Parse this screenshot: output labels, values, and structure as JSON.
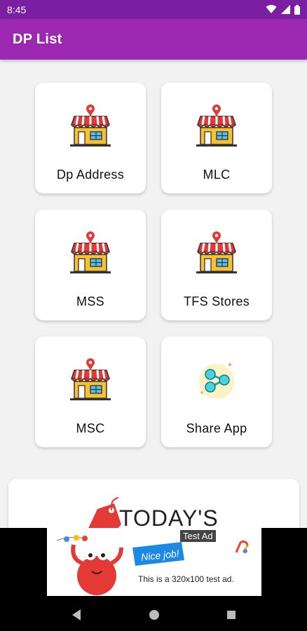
{
  "status_bar": {
    "time": "8:45",
    "icons": [
      "wifi-icon",
      "signal-icon",
      "battery-icon"
    ]
  },
  "app_bar": {
    "title": "DP List"
  },
  "grid": {
    "items": [
      {
        "label": "Dp Address",
        "icon": "store-icon"
      },
      {
        "label": "MLC",
        "icon": "store-icon"
      },
      {
        "label": "MSS",
        "icon": "store-icon"
      },
      {
        "label": "TFS Stores",
        "icon": "store-icon"
      },
      {
        "label": "MSC",
        "icon": "store-icon"
      },
      {
        "label": "Share App",
        "icon": "share-icon"
      }
    ]
  },
  "promo": {
    "text": "TODAY'S"
  },
  "ad": {
    "badge": "Test Ad",
    "flag_text": "Nice job!",
    "text": "This is a 320x100 test ad."
  },
  "nav": {
    "buttons": [
      "back",
      "home",
      "recents"
    ]
  },
  "colors": {
    "status_bar": "#7b1fa2",
    "app_bar": "#9c27b0",
    "background": "#f2f2f2"
  }
}
